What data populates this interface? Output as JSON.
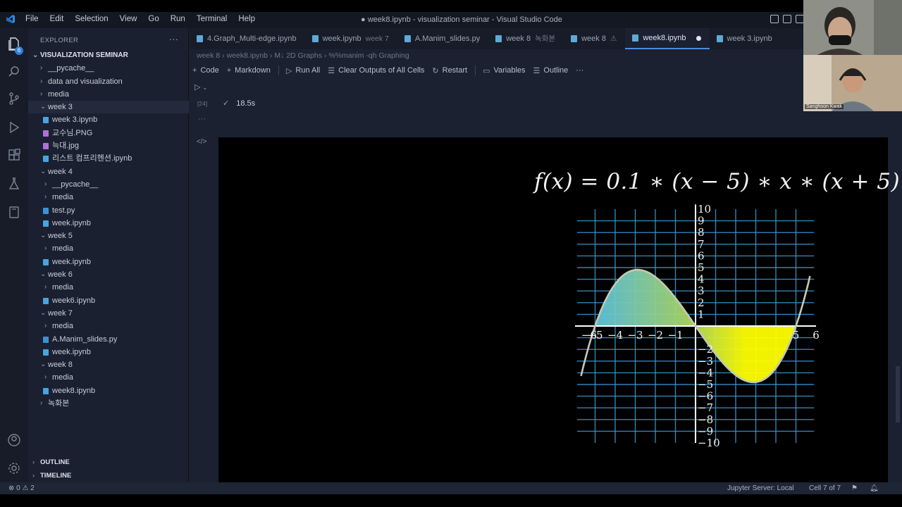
{
  "titlebar": {
    "menus": [
      "File",
      "Edit",
      "Selection",
      "View",
      "Go",
      "Run",
      "Terminal",
      "Help"
    ],
    "title": "● week8.ipynb - visualization seminar - Visual Studio Code"
  },
  "activity": {
    "source_control_badge": "6"
  },
  "sidebar": {
    "header": "EXPLORER",
    "more": "···",
    "items": [
      {
        "label": "VISUALIZATION SEMINAR",
        "type": "root",
        "indent": 0
      },
      {
        "label": "__pycache__",
        "type": "folder",
        "indent": 1
      },
      {
        "label": "data and visualization",
        "type": "folder",
        "indent": 1
      },
      {
        "label": "media",
        "type": "folder",
        "indent": 1
      },
      {
        "label": "week 3",
        "type": "folder-open",
        "indent": 1
      },
      {
        "label": "week 3.ipynb",
        "type": "notebook",
        "indent": 2
      },
      {
        "label": "교수님.PNG",
        "type": "image",
        "indent": 2
      },
      {
        "label": "늑대.jpg",
        "type": "image",
        "indent": 2
      },
      {
        "label": "리스트 컴프리헨션.ipynb",
        "type": "notebook",
        "indent": 2
      },
      {
        "label": "week 4",
        "type": "folder-open",
        "indent": 1
      },
      {
        "label": "__pycache__",
        "type": "folder",
        "indent": 2
      },
      {
        "label": "media",
        "type": "folder",
        "indent": 2
      },
      {
        "label": "test.py",
        "type": "python",
        "indent": 2
      },
      {
        "label": "week.ipynb",
        "type": "notebook",
        "indent": 2
      },
      {
        "label": "week 5",
        "type": "folder-open",
        "indent": 1
      },
      {
        "label": "media",
        "type": "folder",
        "indent": 2
      },
      {
        "label": "week.ipynb",
        "type": "notebook",
        "indent": 2
      },
      {
        "label": "week 6",
        "type": "folder-open",
        "indent": 1
      },
      {
        "label": "media",
        "type": "folder",
        "indent": 2
      },
      {
        "label": "week6.ipynb",
        "type": "notebook",
        "indent": 2
      },
      {
        "label": "week 7",
        "type": "folder-open",
        "indent": 1
      },
      {
        "label": "media",
        "type": "folder",
        "indent": 2
      },
      {
        "label": "A.Manim_slides.py",
        "type": "python",
        "indent": 2
      },
      {
        "label": "week.ipynb",
        "type": "notebook",
        "indent": 2
      },
      {
        "label": "week 8",
        "type": "folder-open",
        "indent": 1
      },
      {
        "label": "media",
        "type": "folder",
        "indent": 2
      },
      {
        "label": "week8.ipynb",
        "type": "notebook",
        "indent": 2
      },
      {
        "label": "녹화본",
        "type": "folder",
        "indent": 1
      }
    ],
    "outline": "OUTLINE",
    "timeline": "TIMELINE"
  },
  "tabs": [
    {
      "label": "4.Graph_Multi-edge.ipynb",
      "sub": "",
      "active": false
    },
    {
      "label": "week.ipynb",
      "sub": "week 7",
      "active": false
    },
    {
      "label": "A.Manim_slides.py",
      "sub": "",
      "active": false
    },
    {
      "label": "week 8",
      "sub": "녹화본",
      "active": false
    },
    {
      "label": "week 8",
      "sub": "⚠",
      "active": false
    },
    {
      "label": "week8.ipynb",
      "sub": "",
      "active": true
    },
    {
      "label": "week 3.ipynb",
      "sub": "",
      "active": false
    }
  ],
  "breadcrumb": "week 8  ›  week8.ipynb  ›  M↓ 2D Graphs  ›  %%manim -qh Graphing",
  "toolbar": {
    "code": "Code",
    "markdown": "Markdown",
    "run_all": "Run All",
    "clear": "Clear Outputs of All Cells",
    "restart": "Restart",
    "variables": "Variables",
    "outline": "Outline",
    "more": "···"
  },
  "cell": {
    "exec_count": "[24]",
    "timing": "18.5s"
  },
  "output": {
    "formula": "f(x) = 0.1 ∗ (x − 5) ∗ x ∗ (x + 5)",
    "chart_data": {
      "type": "line",
      "function": "0.1*(x-5)*x*(x+5)",
      "xlim": [
        -6,
        6
      ],
      "ylim": [
        -10,
        10
      ],
      "x_ticks": [
        -6,
        -5,
        -4,
        -3,
        -2,
        -1,
        5,
        6
      ],
      "y_ticks": [
        10,
        9,
        8,
        7,
        6,
        5,
        4,
        3,
        2,
        1,
        -2,
        -3,
        -4,
        -5,
        -6,
        -7,
        -8,
        -9,
        -10
      ],
      "area_ranges": [
        [
          -5,
          0
        ],
        [
          0,
          5
        ]
      ],
      "colors": {
        "curve": "#c5c9b0",
        "grid": "#3b9bd4",
        "axis": "#ffffff",
        "area_left": "#5cc3e0",
        "area_mid": "#a8d66a",
        "area_right": "#ffff00"
      }
    }
  },
  "statusbar": {
    "problems": "⊗ 0  ⚠ 2",
    "jupyter": "Jupyter Server: Local",
    "cell": "Cell 7 of 7"
  },
  "webcam": {
    "name2": "Sanghoon Kwak"
  }
}
